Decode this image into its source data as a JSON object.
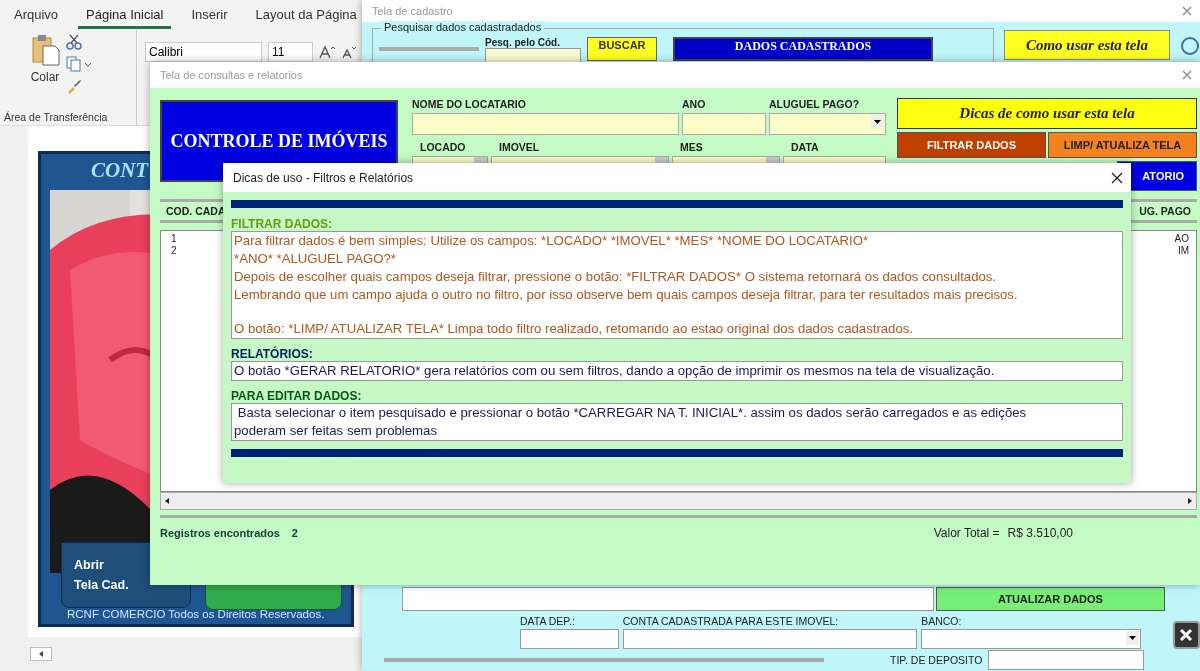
{
  "excel": {
    "tabs": [
      {
        "label": "Arquivo",
        "selected": false
      },
      {
        "label": "Página Inicial",
        "selected": true
      },
      {
        "label": "Inserir",
        "selected": false
      },
      {
        "label": "Layout da Página",
        "selected": false
      }
    ],
    "paste_label": "Colar",
    "clipboard_group": "Área de Transferência",
    "font_name": "Calibri",
    "font_size": "11",
    "banner_title": "CONT",
    "open_button": [
      "Abrir",
      "Tela Cad."
    ],
    "footer": "RCNF COMERCIO Todos os Direitos Reservados."
  },
  "cadastro": {
    "title": "Tela de cadastro",
    "search_group": "Pesquisar dados cadastradados",
    "code_label": "Pesq. pelo Cód.",
    "search_button": "BUSCAR",
    "data_button": "DADOS CADASTRADOS",
    "help_button": "Como usar esta tela",
    "update_button": "ATUALIZAR DADOS",
    "fields": [
      {
        "label": "DATA DEP.:",
        "kind": "text"
      },
      {
        "label": "CONTA CADASTRADA PARA ESTE IMOVEL:",
        "kind": "text"
      },
      {
        "label": "BANCO:",
        "kind": "dropdown"
      }
    ],
    "deposit_label": "TIP. DE DEPOSITO"
  },
  "consultas": {
    "title": "Tela de consultas e relatorios",
    "logo": "CONTROLE DE IMÓVEIS",
    "filters_row1": [
      {
        "label": "NOME DO LOCATARIO",
        "kind": "text"
      },
      {
        "label": "ANO",
        "kind": "text"
      },
      {
        "label": "ALUGUEL PAGO?",
        "kind": "dropdown"
      }
    ],
    "filters_row2": [
      {
        "label": "LOCADO",
        "kind": "dropdown"
      },
      {
        "label": "IMOVEL",
        "kind": "dropdown"
      },
      {
        "label": "MES",
        "kind": "dropdown"
      },
      {
        "label": "DATA",
        "kind": "text"
      }
    ],
    "tips_button": "Dicas de como usar esta tela",
    "filter_button": "FILTRAR DADOS",
    "clear_button": "LIMP/ ATUALIZA TELA",
    "report_button": "ATORIO",
    "columns": [
      "COD. CADA",
      "UG. PAGO"
    ],
    "rows": [
      {
        "column_1": "1",
        "column_2": "AO"
      },
      {
        "column_1": "2",
        "column_2": "IM"
      }
    ],
    "records_label": "Registros encontrados",
    "records_count": "2",
    "total_label": "Valor Total =",
    "total_value": "R$ 3.510,00"
  },
  "dialog": {
    "title": "Dicas de uso - Filtros e Relatórios",
    "sections": [
      {
        "kind": "filter",
        "heading": "FILTRAR DADOS:",
        "paragraphs": [
          [
            "Para filtrar dados é bem simples: Utilize os campos: *LOCADO* *IMOVEL* *MES* *NOME DO LOCATARIO*",
            "*ANO* *ALUGUEL PAGO?*",
            "Depois de escolher quais campos deseja filtrar, pressione o botão: *FILTRAR DADOS* O sistema retornará os dados consultados.",
            "Lembrando que um campo ajuda o outro no filtro, por isso observe bem quais campos deseja filtrar, para ter resultados mais precisos."
          ],
          [
            "O botão: *LIMP/ ATUALIZAR TELA* Limpa todo filtro realizado, retomando ao estao original dos dados cadastrados."
          ]
        ]
      },
      {
        "kind": "report",
        "heading": "RELATÓRIOS:",
        "paragraphs": [
          [
            "O botão *GERAR RELATORIO* gera relatórios com ou sem filtros, dando a opção de imprimir os mesmos na tela de visualização."
          ]
        ]
      },
      {
        "kind": "edit",
        "heading": "PARA EDITAR DADOS:",
        "paragraphs": [
          [
            " Basta selecionar o item pesquisado e pressionar o botão *CARREGAR NA T. INICIAL*. assim os dados serão carregados e as edições",
            "poderam ser feitas sem problemas"
          ]
        ]
      }
    ]
  }
}
